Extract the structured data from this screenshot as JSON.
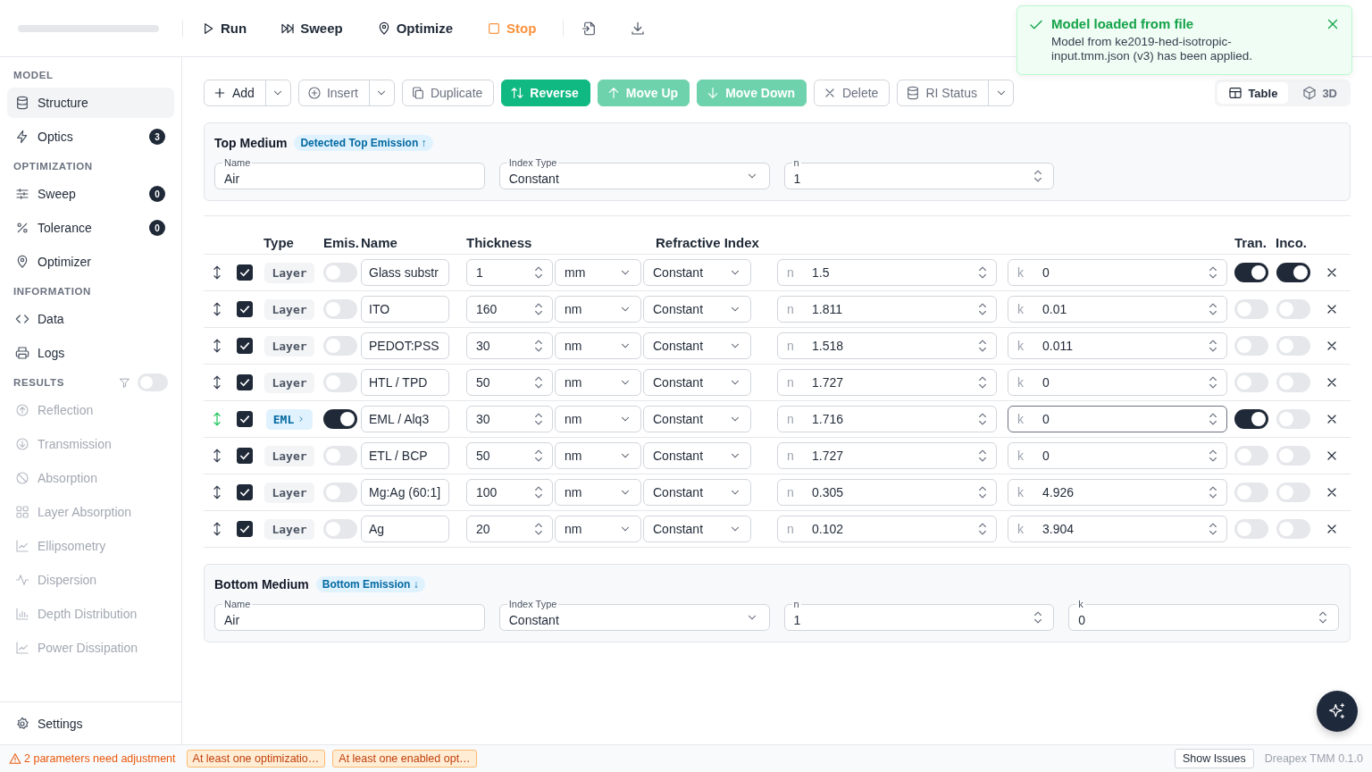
{
  "header": {
    "run_buttons": [
      {
        "label": "Run",
        "kind": "normal"
      },
      {
        "label": "Sweep",
        "kind": "normal"
      },
      {
        "label": "Optimize",
        "kind": "normal"
      },
      {
        "label": "Stop",
        "kind": "stop"
      }
    ]
  },
  "sidebar": {
    "sections": [
      {
        "title": "MODEL",
        "items": [
          {
            "label": "Structure",
            "selected": true,
            "disabled": false
          },
          {
            "label": "Optics",
            "selected": false,
            "disabled": false,
            "badge": "3"
          }
        ]
      },
      {
        "title": "OPTIMIZATION",
        "items": [
          {
            "label": "Sweep",
            "selected": false,
            "disabled": false,
            "badge": "0"
          },
          {
            "label": "Tolerance",
            "selected": false,
            "disabled": false,
            "badge": "0"
          },
          {
            "label": "Optimizer",
            "selected": false,
            "disabled": false
          }
        ]
      },
      {
        "title": "INFORMATION",
        "items": [
          {
            "label": "Data",
            "selected": false,
            "disabled": false
          },
          {
            "label": "Logs",
            "selected": false,
            "disabled": false
          }
        ]
      },
      {
        "title": "RESULTS",
        "filter_toggle": {
          "on": false
        },
        "items": [
          {
            "label": "Reflection",
            "selected": false,
            "disabled": true
          },
          {
            "label": "Transmission",
            "selected": false,
            "disabled": true
          },
          {
            "label": "Absorption",
            "selected": false,
            "disabled": true
          },
          {
            "label": "Layer Absorption",
            "selected": false,
            "disabled": true
          },
          {
            "label": "Ellipsometry",
            "selected": false,
            "disabled": true
          },
          {
            "label": "Dispersion",
            "selected": false,
            "disabled": true
          },
          {
            "label": "Depth Distribution",
            "selected": false,
            "disabled": true
          },
          {
            "label": "Power Dissipation",
            "selected": false,
            "disabled": true
          }
        ]
      }
    ],
    "settings": {
      "label": "Settings"
    }
  },
  "toolbar": {
    "actions": [
      {
        "label": "Add",
        "kind": "split",
        "disabled": false
      },
      {
        "label": "Insert",
        "kind": "split",
        "disabled": true
      },
      {
        "label": "Duplicate",
        "kind": "plain",
        "disabled": true
      },
      {
        "label": "Reverse",
        "kind": "primary",
        "disabled": false
      },
      {
        "label": "Move Up",
        "kind": "primary",
        "disabled": true
      },
      {
        "label": "Move Down",
        "kind": "primary",
        "disabled": true
      },
      {
        "label": "Delete",
        "kind": "plain",
        "disabled": true
      },
      {
        "label": "RI Status",
        "kind": "split",
        "disabled": true
      }
    ],
    "view_tabs": [
      {
        "label": "Table",
        "selected": true
      },
      {
        "label": "3D",
        "selected": false
      }
    ]
  },
  "top_medium": {
    "title": "Top Medium",
    "badge": "Detected Top Emission ↑",
    "fields": [
      {
        "label": "Name",
        "value": "Air",
        "kind": "text"
      },
      {
        "label": "Index Type",
        "value": "Constant",
        "kind": "select"
      },
      {
        "label": "n",
        "value": "1",
        "kind": "number"
      }
    ]
  },
  "layers": {
    "columns": [
      "Type",
      "Emis.",
      "Name",
      "Thickness",
      "Refractive Index",
      "Tran.",
      "Inco."
    ],
    "rows": [
      {
        "enabled": true,
        "kind": "layer",
        "type": "Layer",
        "emissive": false,
        "name": "Glass substr",
        "thickness": "1",
        "unit": "mm",
        "index_type": "Constant",
        "n_label": "n",
        "n": "1.5",
        "k_label": "k",
        "k": "0",
        "focused": false,
        "tran": true,
        "inco": true
      },
      {
        "enabled": true,
        "kind": "layer",
        "type": "Layer",
        "emissive": false,
        "name": "ITO",
        "thickness": "160",
        "unit": "nm",
        "index_type": "Constant",
        "n_label": "n",
        "n": "1.811",
        "k_label": "k",
        "k": "0.01",
        "focused": false,
        "tran": false,
        "inco": false
      },
      {
        "enabled": true,
        "kind": "layer",
        "type": "Layer",
        "emissive": false,
        "name": "PEDOT:PSS",
        "thickness": "30",
        "unit": "nm",
        "index_type": "Constant",
        "n_label": "n",
        "n": "1.518",
        "k_label": "k",
        "k": "0.011",
        "focused": false,
        "tran": false,
        "inco": false
      },
      {
        "enabled": true,
        "kind": "layer",
        "type": "Layer",
        "emissive": false,
        "name": "HTL / TPD",
        "thickness": "50",
        "unit": "nm",
        "index_type": "Constant",
        "n_label": "n",
        "n": "1.727",
        "k_label": "k",
        "k": "0",
        "focused": false,
        "tran": false,
        "inco": false
      },
      {
        "enabled": true,
        "kind": "eml",
        "type": "EML",
        "emissive": true,
        "name": "EML / Alq3",
        "thickness": "30",
        "unit": "nm",
        "index_type": "Constant",
        "n_label": "n",
        "n": "1.716",
        "k_label": "k",
        "k": "0",
        "focused": true,
        "tran": true,
        "inco": false
      },
      {
        "enabled": true,
        "kind": "layer",
        "type": "Layer",
        "emissive": false,
        "name": "ETL / BCP",
        "thickness": "50",
        "unit": "nm",
        "index_type": "Constant",
        "n_label": "n",
        "n": "1.727",
        "k_label": "k",
        "k": "0",
        "focused": false,
        "tran": false,
        "inco": false
      },
      {
        "enabled": true,
        "kind": "layer",
        "type": "Layer",
        "emissive": false,
        "name": "Mg:Ag (60:1]",
        "thickness": "100",
        "unit": "nm",
        "index_type": "Constant",
        "n_label": "n",
        "n": "0.305",
        "k_label": "k",
        "k": "4.926",
        "focused": false,
        "tran": false,
        "inco": false
      },
      {
        "enabled": true,
        "kind": "layer",
        "type": "Layer",
        "emissive": false,
        "name": "Ag",
        "thickness": "20",
        "unit": "nm",
        "index_type": "Constant",
        "n_label": "n",
        "n": "0.102",
        "k_label": "k",
        "k": "3.904",
        "focused": false,
        "tran": false,
        "inco": false
      }
    ]
  },
  "bottom_medium": {
    "title": "Bottom Medium",
    "badge": "Bottom Emission ↓",
    "fields": [
      {
        "label": "Name",
        "value": "Air",
        "kind": "text"
      },
      {
        "label": "Index Type",
        "value": "Constant",
        "kind": "select"
      },
      {
        "label": "n",
        "value": "1",
        "kind": "number"
      },
      {
        "label": "k",
        "value": "0",
        "kind": "number"
      }
    ]
  },
  "toast": {
    "title": "Model loaded from file",
    "message": "Model from ke2019-hed-isotropic-input.tmm.json (v3) has been applied."
  },
  "status_bar": {
    "warning": "2 parameters need adjustment",
    "chips": [
      "At least one optimizatio…",
      "At least one enabled opt…"
    ],
    "button": "Show Issues",
    "version": "Dreapex TMM 0.1.0"
  }
}
